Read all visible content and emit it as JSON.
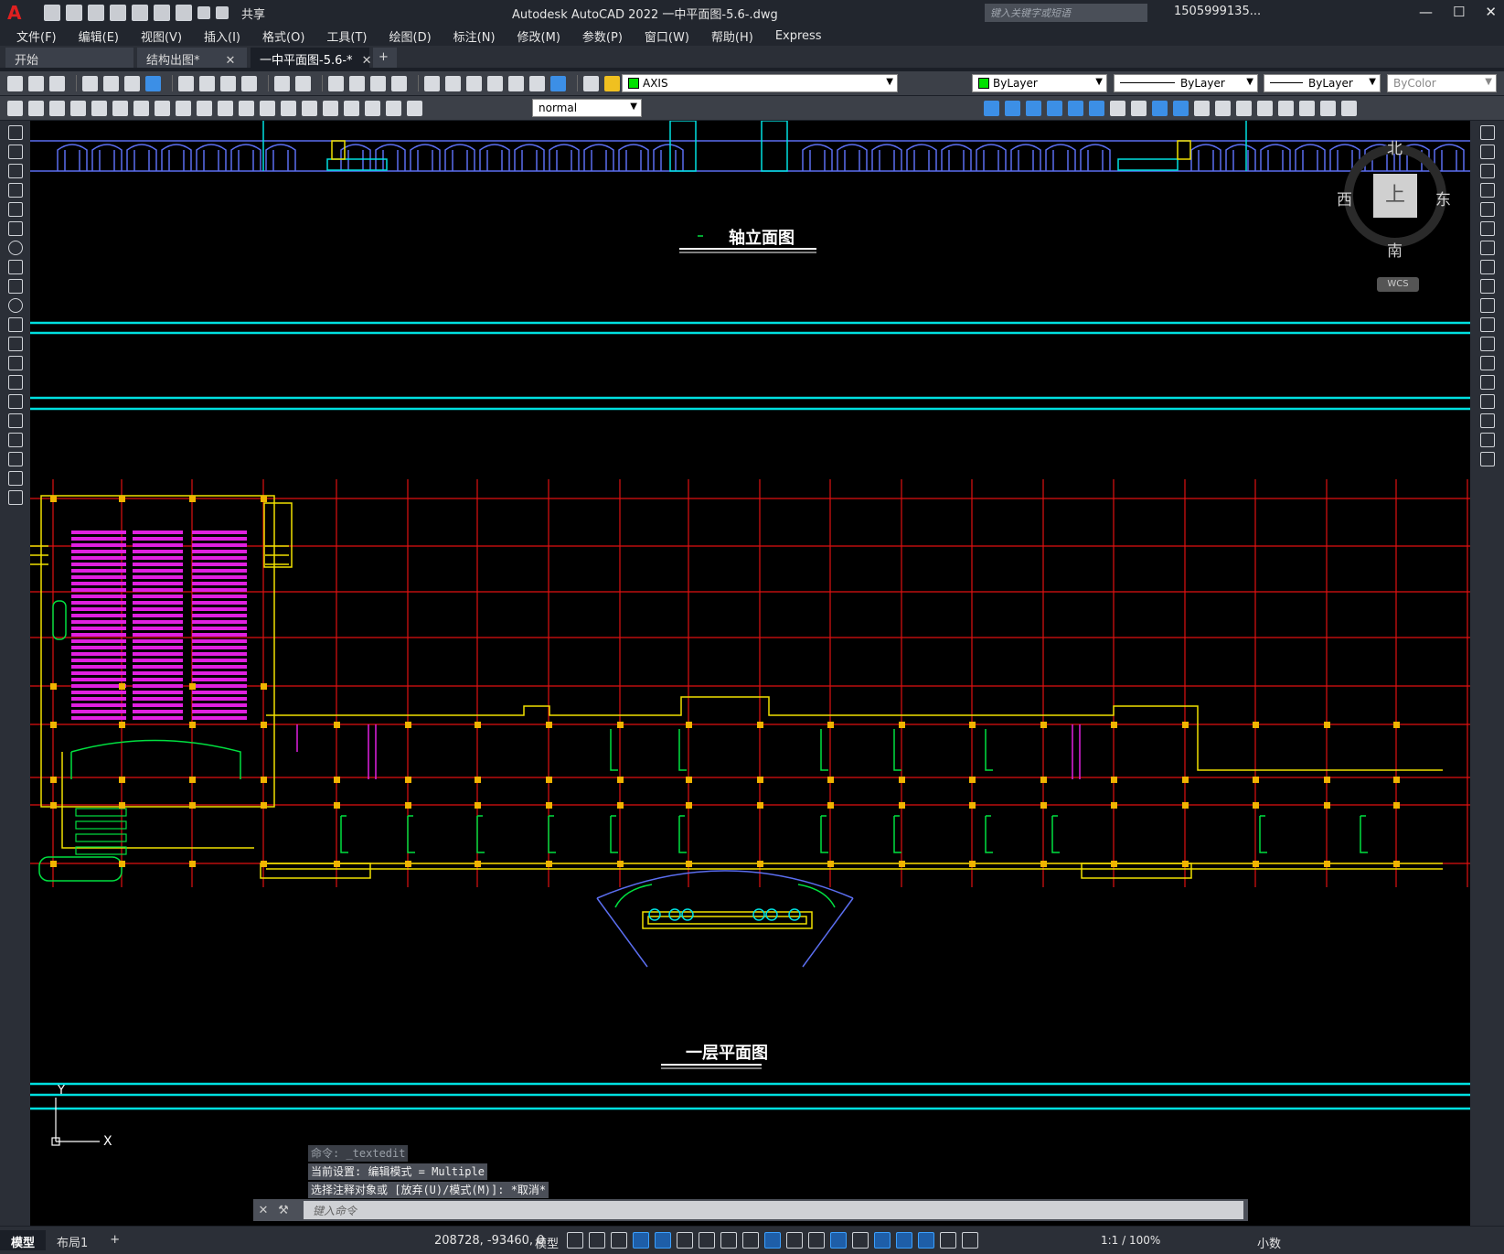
{
  "app": {
    "logo": "A",
    "title": "Autodesk AutoCAD 2022    一中平面图-5.6-.dwg",
    "share": "共享",
    "search_placeholder": "键入关键字或短语",
    "user": "1505999135...",
    "min": "—",
    "max": "☐",
    "close": "✕"
  },
  "menu": [
    "文件(F)",
    "编辑(E)",
    "视图(V)",
    "插入(I)",
    "格式(O)",
    "工具(T)",
    "绘图(D)",
    "标注(N)",
    "修改(M)",
    "参数(P)",
    "窗口(W)",
    "帮助(H)",
    "Express"
  ],
  "tabs": [
    {
      "label": "开始",
      "closable": false
    },
    {
      "label": "结构出图*",
      "closable": true
    },
    {
      "label": "一中平面图-5.6-*",
      "closable": true,
      "active": true
    }
  ],
  "tab_plus": "+",
  "toolbar": {
    "layer": "AXIS",
    "layer_color": "#00e000",
    "color": "ByLayer",
    "linetype": "ByLayer",
    "lineweight": "ByLayer",
    "plotstyle": "ByColor",
    "textstyle": "normal"
  },
  "viewcube": {
    "north": "北",
    "south": "南",
    "east": "东",
    "west": "西",
    "face": "上",
    "wcs": "WCS"
  },
  "drawing": {
    "title_elevation": "轴立面图",
    "title_plan": "一层平面图",
    "ucs_y": "Y",
    "ucs_x": "X"
  },
  "command": {
    "history": [
      "命令: _textedit",
      "当前设置: 编辑模式 = Multiple",
      "选择注释对象或 [放弃(U)/模式(M)]: *取消*"
    ],
    "placeholder": "键入命令"
  },
  "status": {
    "layout_tabs": [
      "模型",
      "布局1"
    ],
    "tab_plus": "+",
    "coords": "208728, -93460, 0",
    "model": "模型",
    "scale": "1:1 / 100%",
    "units": "小数"
  },
  "colors": {
    "grid": "#e01010",
    "cyan": "#00e0e0",
    "yellow": "#f0e000",
    "magenta": "#e020e0",
    "green": "#00e040",
    "blue": "#5b6ef0",
    "orange_node": "#f0b400"
  }
}
